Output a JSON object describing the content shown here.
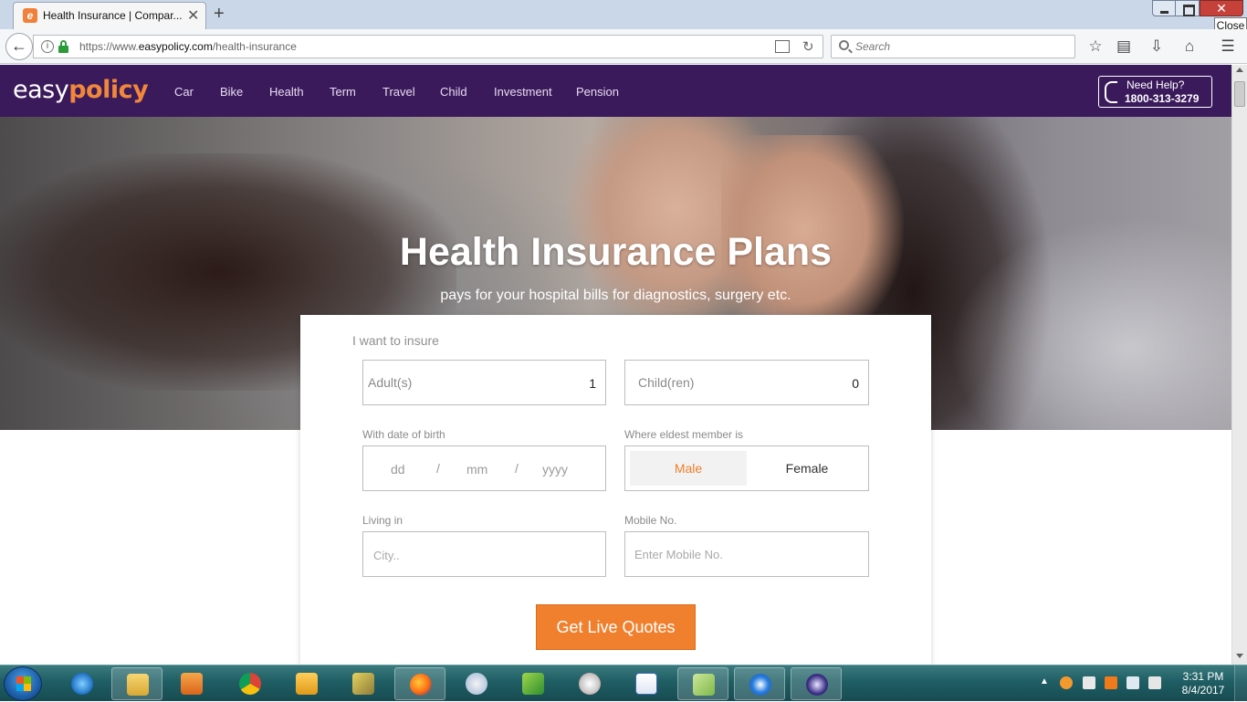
{
  "browser": {
    "tab_title": "Health Insurance | Compar...",
    "tab_favicon": "e",
    "tab_close": "✕",
    "new_tab": "+",
    "url_prefix": "https://www.",
    "url_domain": "easypolicy.com",
    "url_path": "/health-insurance",
    "search_placeholder": "Search",
    "close_tooltip": "Close",
    "close_glyph": "✕",
    "toolbar_icons": [
      "bookmark-star-icon",
      "library-icon",
      "downloads-icon",
      "home-icon",
      "menu-icon"
    ]
  },
  "site": {
    "logo_easy": "easy",
    "logo_policy": "policy",
    "nav": [
      {
        "label": "Car"
      },
      {
        "label": "Bike"
      },
      {
        "label": "Health"
      },
      {
        "label": "Term"
      },
      {
        "label": "Travel"
      },
      {
        "label": "Child"
      },
      {
        "label": "Investment"
      },
      {
        "label": "Pension"
      }
    ],
    "help_label": "Need Help?",
    "help_phone": "1800-313-3279",
    "accent_color": "#f0802d",
    "header_color": "#3b1a5c"
  },
  "hero": {
    "title": "Health Insurance Plans",
    "subtitle": "pays for your hospital bills for diagnostics, surgery etc."
  },
  "form": {
    "insure_label": "I want to insure",
    "adults_label": "Adult(s)",
    "adults_value": "1",
    "children_label": "Child(ren)",
    "children_value": "0",
    "dob_label": "With date of birth",
    "dob_day": "dd",
    "dob_month": "mm",
    "dob_year": "yyyy",
    "dob_sep": "/",
    "eldest_label": "Where eldest member is",
    "gender_male": "Male",
    "gender_female": "Female",
    "gender_selected": "Male",
    "living_label": "Living in",
    "city_placeholder": "City..",
    "mobile_label": "Mobile No.",
    "mobile_placeholder": "Enter Mobile No.",
    "submit_label": "Get Live Quotes"
  },
  "taskbar": {
    "time": "3:31 PM",
    "date": "8/4/2017",
    "apps": [
      "internet-explorer-icon",
      "file-explorer-icon",
      "media-player-icon",
      "chrome-icon",
      "outlook-icon",
      "tools-icon",
      "firefox-icon",
      "paint-icon",
      "excel-icon",
      "snipping-icon",
      "vc-icon",
      "folder-icon",
      "teamviewer-icon",
      "eclipse-icon"
    ]
  }
}
